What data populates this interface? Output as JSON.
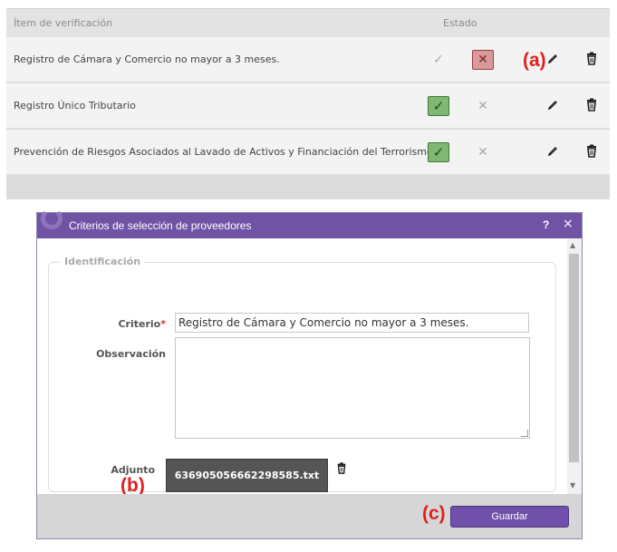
{
  "table": {
    "header_item": "Ítem de verificación",
    "header_estado": "Estado",
    "rows": [
      {
        "label": "Registro de Cámara y Comercio no mayor a 3 meses.",
        "status": "rejected"
      },
      {
        "label": "Registro Único Tributario",
        "status": "approved"
      },
      {
        "label": "Prevención de Riesgos Asociados al Lavado de Activos y Financiación del Terrorismo",
        "status": "approved"
      }
    ],
    "check_glyph": "✓",
    "cross_glyph": "✕"
  },
  "callouts": {
    "a": "(a)",
    "b": "(b)",
    "c": "(c)"
  },
  "dialog": {
    "title": "Criterios de selección de proveedores",
    "help": "?",
    "close": "×",
    "section": "Identificación",
    "criterio_label": "Criterio",
    "required_mark": "*",
    "criterio_value": "Registro de Cámara y Comercio no mayor a 3 meses.",
    "observacion_label": "Observación",
    "adjunto_label": "Adjunto",
    "file_name": "636905056662298585.txt",
    "save_label": "Guardar"
  },
  "colors": {
    "dialog_header": "#7153a6",
    "save_button": "#7050a8",
    "approved": "#7fb872",
    "rejected": "#d89a9a",
    "callout": "#e02020"
  },
  "icons": {
    "edit": "pencil-icon",
    "delete": "trash-icon",
    "approve": "check-icon",
    "reject": "x-icon"
  }
}
